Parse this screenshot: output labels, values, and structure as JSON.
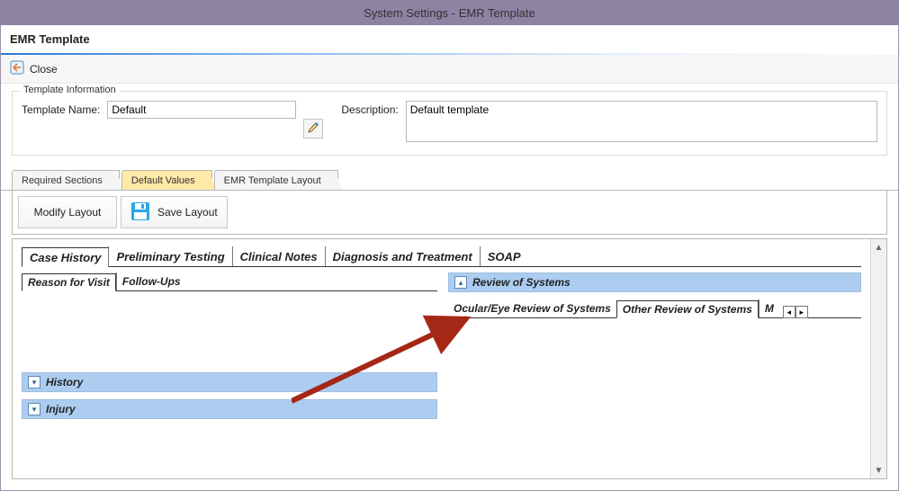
{
  "window_title": "System Settings - EMR Template",
  "page_title": "EMR Template",
  "toolbar": {
    "close_label": "Close"
  },
  "template_info": {
    "legend": "Template Information",
    "name_label": "Template Name:",
    "name_value": "Default",
    "description_label": "Description:",
    "description_value": "Default template"
  },
  "main_tabs": {
    "required": "Required Sections",
    "defaults": "Default Values",
    "layout": "EMR Template Layout"
  },
  "layout_buttons": {
    "modify": "Modify Layout",
    "save": "Save Layout"
  },
  "inner_tabs": {
    "case_history": "Case History",
    "preliminary": "Preliminary Testing",
    "clinical": "Clinical Notes",
    "diagnosis": "Diagnosis and Treatment",
    "soap": "SOAP"
  },
  "case_history": {
    "reason_tab": "Reason for Visit",
    "followups_tab": "Follow-Ups",
    "ros_title": "Review of Systems",
    "ros_tabs": {
      "ocular": "Ocular/Eye Review of Systems",
      "other": "Other Review of Systems",
      "more": "M"
    },
    "history_title": "History",
    "injury_title": "Injury"
  }
}
